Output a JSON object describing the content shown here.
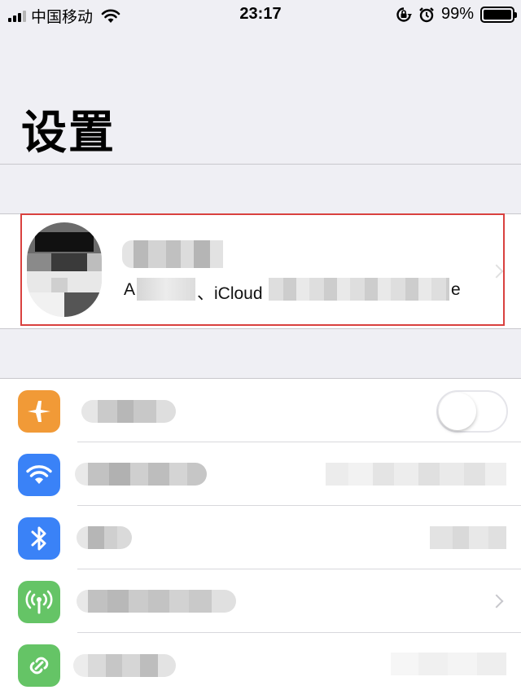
{
  "status_bar": {
    "carrier": "中国移动",
    "time": "23:17",
    "battery_text": "99%",
    "battery_level": 0.99,
    "icons": [
      "signal-icon",
      "wifi-icon",
      "rotation-lock-icon",
      "alarm-icon",
      "battery-icon"
    ]
  },
  "header": {
    "title": "设置"
  },
  "profile": {
    "subtitle_prefix": "A",
    "subtitle_icloud": "、iCloud",
    "subtitle_suffix": "e"
  },
  "settings_rows": [
    {
      "icon": "airplane-icon",
      "color": "#f19a37",
      "control": "toggle",
      "toggle_on": false
    },
    {
      "icon": "wifi-icon",
      "color": "#3a82f7",
      "control": "value"
    },
    {
      "icon": "bluetooth-icon",
      "color": "#3a82f7",
      "control": "value"
    },
    {
      "icon": "cellular-icon",
      "color": "#65c466",
      "control": "chevron"
    },
    {
      "icon": "hotspot-icon",
      "color": "#65c466",
      "control": "value"
    }
  ],
  "colors": {
    "highlight_border": "#d9413f",
    "background": "#efeff4",
    "separator": "#c8c7cc"
  }
}
